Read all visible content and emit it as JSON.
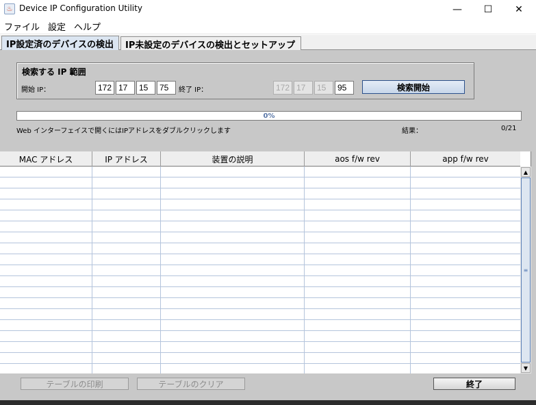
{
  "window": {
    "title": "Device IP Configuration Utility",
    "app_icon": "java-cup-icon",
    "controls": {
      "minimize": "—",
      "maximize": "☐",
      "close": "✕"
    }
  },
  "menu": [
    "ファイル",
    "設定",
    "ヘルプ"
  ],
  "tabs": [
    {
      "label": "IP設定済のデバイスの検出",
      "active": true
    },
    {
      "label": "IP未設定のデバイスの検出とセットアップ",
      "active": false
    }
  ],
  "search": {
    "title": "検索する IP 範囲",
    "start_label": "開始 IP：",
    "end_label": "終了 IP：",
    "start_ip": [
      "172",
      "17",
      "15",
      "75"
    ],
    "end_ip": [
      "172",
      "17",
      "15",
      "95"
    ],
    "start_button": "検索開始"
  },
  "progress": {
    "text": "0%",
    "value": 0
  },
  "hint": "Web インターフェイスで開くにはIPアドレスをダブルクリックします",
  "result": {
    "label": "結果：",
    "value": "0/21"
  },
  "table": {
    "columns": [
      "MAC アドレス",
      "IP アドレス",
      "装置の説明",
      "aos f/w rev",
      "app f/w rev"
    ],
    "rows": []
  },
  "buttons": {
    "print": "テーブルの印刷",
    "clear": "テーブルのクリア",
    "exit": "終了"
  },
  "colors": {
    "panel": "#c8c8c8",
    "active_tab": "#dbe5f1",
    "progress_text": "#5b78a8",
    "row_line": "#b4c4dc"
  }
}
